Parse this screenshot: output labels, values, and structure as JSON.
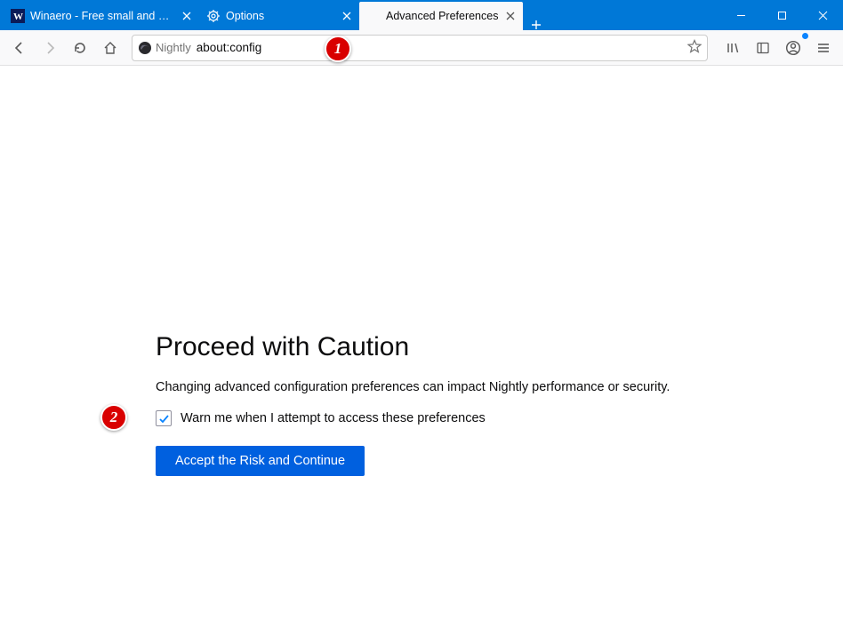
{
  "tabs": [
    {
      "label": "Winaero - Free small and usef…"
    },
    {
      "label": "Options"
    },
    {
      "label": "Advanced Preferences"
    }
  ],
  "urlbar": {
    "identity_label": "Nightly",
    "url": "about:config"
  },
  "page": {
    "title": "Proceed with Caution",
    "description": "Changing advanced configuration preferences can impact Nightly performance or security.",
    "checkbox_label": "Warn me when I attempt to access these preferences",
    "accept_button": "Accept the Risk and Continue"
  },
  "callouts": {
    "one": "1",
    "two": "2"
  }
}
